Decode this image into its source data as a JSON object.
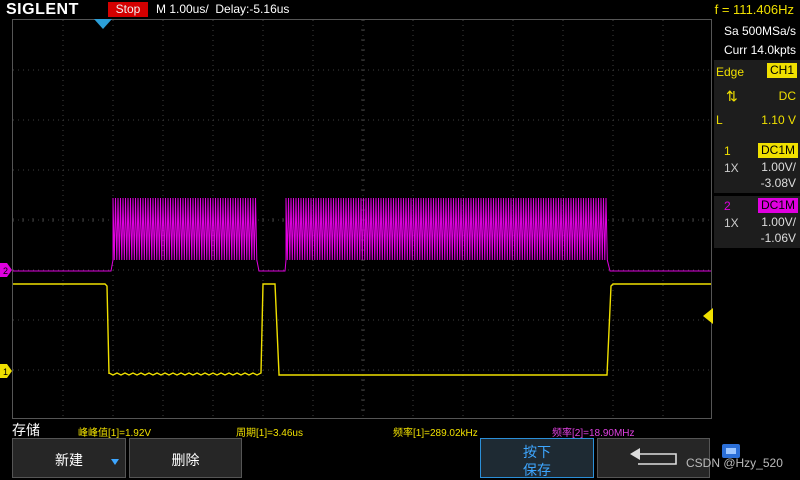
{
  "header": {
    "brand": "SIGLENT",
    "run_state": "Stop",
    "timebase": "M 1.00us/",
    "delay": "Delay:-5.16us",
    "frequency": "f = 111.406Hz"
  },
  "acquisition": {
    "sample_rate": "Sa 500MSa/s",
    "memory_depth": "Curr 14.0kpts"
  },
  "trigger": {
    "type": "Edge",
    "source": "CH1",
    "slope_symbol": "⇅",
    "coupling": "DC",
    "level_label": "L",
    "level": "1.10 V"
  },
  "channels": [
    {
      "number": "1",
      "coupling": "DC1M",
      "probe": "1X",
      "scale": "1.00V/",
      "offset": "-3.08V",
      "color": "#f0e000"
    },
    {
      "number": "2",
      "coupling": "DC1M",
      "probe": "1X",
      "scale": "1.00V/",
      "offset": "-1.06V",
      "color": "#e000e0"
    }
  ],
  "markers": {
    "ch1": "1",
    "ch2": "2"
  },
  "measurements": [
    {
      "text": "峰峰值[1]=1.92V",
      "color": "#f0e000"
    },
    {
      "text": "周期[1]=3.46us",
      "color": "#f0e000"
    },
    {
      "text": "频率[1]=289.02kHz",
      "color": "#f0e000"
    },
    {
      "text": "频率[2]=18.90MHz",
      "color": "#e040e0"
    }
  ],
  "softkeys": {
    "menu_title": "存储",
    "new": "新建",
    "delete": "删除",
    "press_save_line1": "按下",
    "press_save_line2": "保存"
  },
  "watermark": "CSDN @Hzy_520",
  "colors": {
    "ch1": "#f0e000",
    "ch2": "#e000e0",
    "grid": "#404040",
    "accent": "#3da6ff"
  },
  "icons": {
    "trigger_position": "trigger-position-marker-icon",
    "trigger_level": "trigger-level-marker-icon",
    "back": "return-arrow-icon",
    "usb": "usb-storage-icon"
  }
}
